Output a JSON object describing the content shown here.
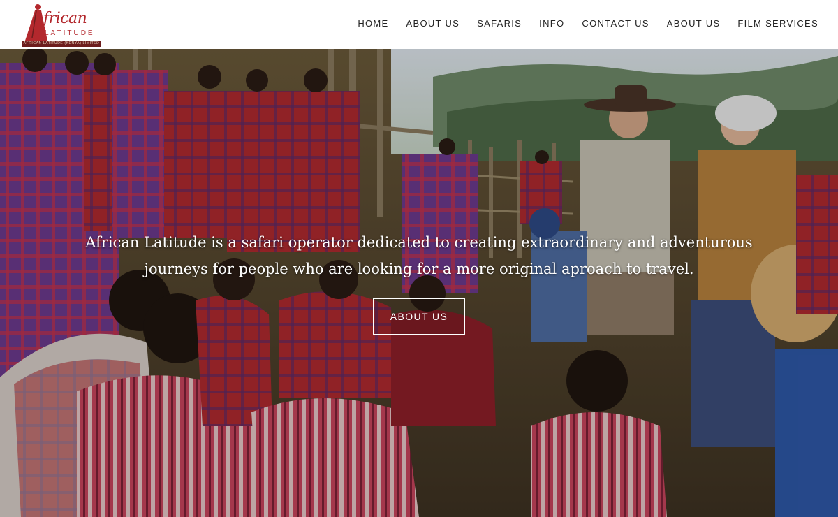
{
  "brand": {
    "logo_word": "frican",
    "logo_sub": "LATITUDE",
    "logo_bar": "AFRICAN LATITUDE (KENYA) LIMITED"
  },
  "nav": {
    "items": [
      {
        "label": "HOME"
      },
      {
        "label": "ABOUT US"
      },
      {
        "label": "SAFARIS"
      },
      {
        "label": "INFO"
      },
      {
        "label": "CONTACT US"
      },
      {
        "label": "ABOUT US"
      },
      {
        "label": "FILM SERVICES"
      }
    ]
  },
  "hero": {
    "tagline_line1": "African Latitude is a safari operator dedicated to creating extraordinary and adventurous",
    "tagline_line2": "journeys for people who are looking for a more original aproach to travel.",
    "cta_label": "ABOUT US"
  },
  "colors": {
    "brand_red": "#b3282d",
    "nav_text": "#222222",
    "hero_text": "#ffffff"
  },
  "icons": [
    "logo-maasai-figure-icon"
  ]
}
